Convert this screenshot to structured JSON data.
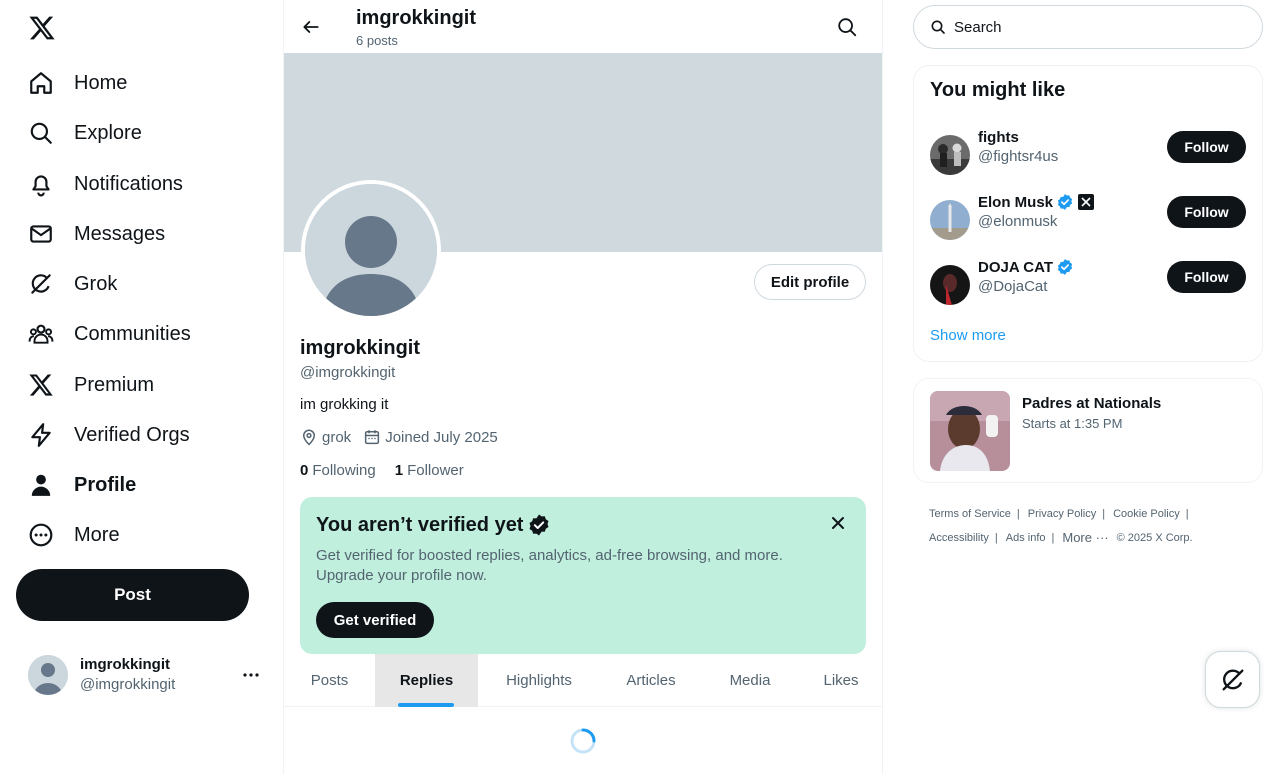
{
  "sidebar": {
    "items": [
      {
        "label": "Home",
        "icon": "home-icon"
      },
      {
        "label": "Explore",
        "icon": "search-icon"
      },
      {
        "label": "Notifications",
        "icon": "bell-icon"
      },
      {
        "label": "Messages",
        "icon": "envelope-icon"
      },
      {
        "label": "Grok",
        "icon": "grok-icon"
      },
      {
        "label": "Communities",
        "icon": "communities-icon"
      },
      {
        "label": "Premium",
        "icon": "x-logo-icon"
      },
      {
        "label": "Verified Orgs",
        "icon": "lightning-icon"
      },
      {
        "label": "Profile",
        "icon": "person-icon",
        "active": true
      },
      {
        "label": "More",
        "icon": "more-circle-icon"
      }
    ],
    "post_label": "Post",
    "account": {
      "name": "imgrokkingit",
      "handle": "@imgrokkingit"
    }
  },
  "header": {
    "name": "imgrokkingit",
    "posts_count": "6 posts"
  },
  "profile": {
    "name": "imgrokkingit",
    "handle": "@imgrokkingit",
    "bio": "im grokking it",
    "location": "grok",
    "joined": "Joined July 2025",
    "following_count": "0",
    "following_label": "Following",
    "followers_count": "1",
    "followers_label": "Follower",
    "edit_label": "Edit profile"
  },
  "verify_card": {
    "title": "You aren’t verified yet",
    "line1": "Get verified for boosted replies, analytics, ad-free browsing, and more.",
    "line2": "Upgrade your profile now.",
    "button": "Get verified"
  },
  "tabs": [
    {
      "label": "Posts"
    },
    {
      "label": "Replies",
      "active": true
    },
    {
      "label": "Highlights"
    },
    {
      "label": "Articles"
    },
    {
      "label": "Media"
    },
    {
      "label": "Likes"
    }
  ],
  "search": {
    "placeholder": "Search"
  },
  "who_to_follow": {
    "title": "You might like",
    "show_more": "Show more",
    "follow_label": "Follow",
    "users": [
      {
        "name": "fights",
        "handle": "@fightsr4us",
        "verified": false,
        "affiliate": false
      },
      {
        "name": "Elon Musk",
        "handle": "@elonmusk",
        "verified": true,
        "affiliate": true
      },
      {
        "name": "DOJA CAT",
        "handle": "@DojaCat",
        "verified": true,
        "affiliate": false
      }
    ]
  },
  "event": {
    "title": "Padres at Nationals",
    "time": "Starts at 1:35 PM"
  },
  "footer": {
    "row1": [
      "Terms of Service",
      "Privacy Policy",
      "Cookie Policy"
    ],
    "row2": [
      "Accessibility",
      "Ads info"
    ],
    "more": "More",
    "copyright": "© 2025 X Corp."
  },
  "colors": {
    "accent": "#1d9bf0",
    "verify_card_bg": "#c1efdd",
    "banner": "#cfd9de",
    "text_primary": "#0f1419",
    "text_secondary": "#536471"
  }
}
